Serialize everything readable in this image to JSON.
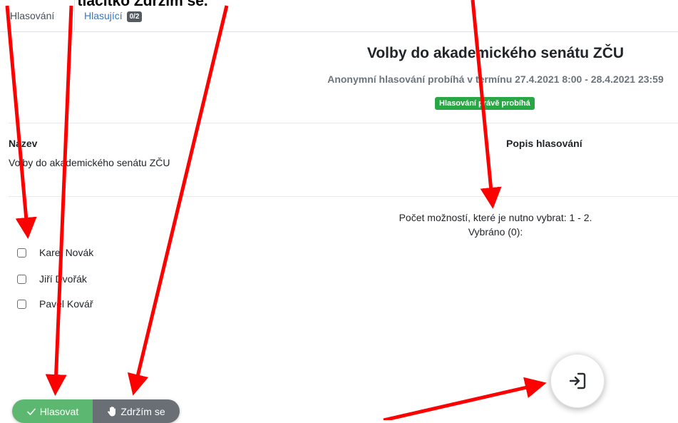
{
  "caption": "hlasovat a tlačítko Zdržím se.",
  "tabs": {
    "voting": "Hlasování",
    "voters": "Hlasující",
    "voters_count": "0/2"
  },
  "election": {
    "title": "Volby do akademického senátu ZČU",
    "subtitle": "Anonymní hlasování probíhá v termínu 27.4.2021 8:00 - 28.4.2021 23:59",
    "status": "Hlasování právě probíhá"
  },
  "details": {
    "name_label": "Název",
    "name_value": "Volby do akademického senátu ZČU",
    "description_label": "Popis hlasování"
  },
  "selection": {
    "hint": "Počet možností, které je nutno vybrat: 1 - 2.",
    "selected": "Vybráno (0):"
  },
  "options": [
    {
      "label": "Karel Novák",
      "checked": false
    },
    {
      "label": "Jiří Dvořák",
      "checked": false
    },
    {
      "label": "Pavel Kovář",
      "checked": false
    }
  ],
  "actions": {
    "vote": "Hlasovat",
    "abstain": "Zdržím se"
  },
  "icons": {
    "vote": "check-icon",
    "abstain": "hand-icon",
    "exit": "exit-icon"
  },
  "colors": {
    "accent_link": "#3a77c0",
    "status_green": "#28a745",
    "vote_green": "#5cb870",
    "abstain_gray": "#6a6f75",
    "annotation_red": "#ff0000"
  }
}
